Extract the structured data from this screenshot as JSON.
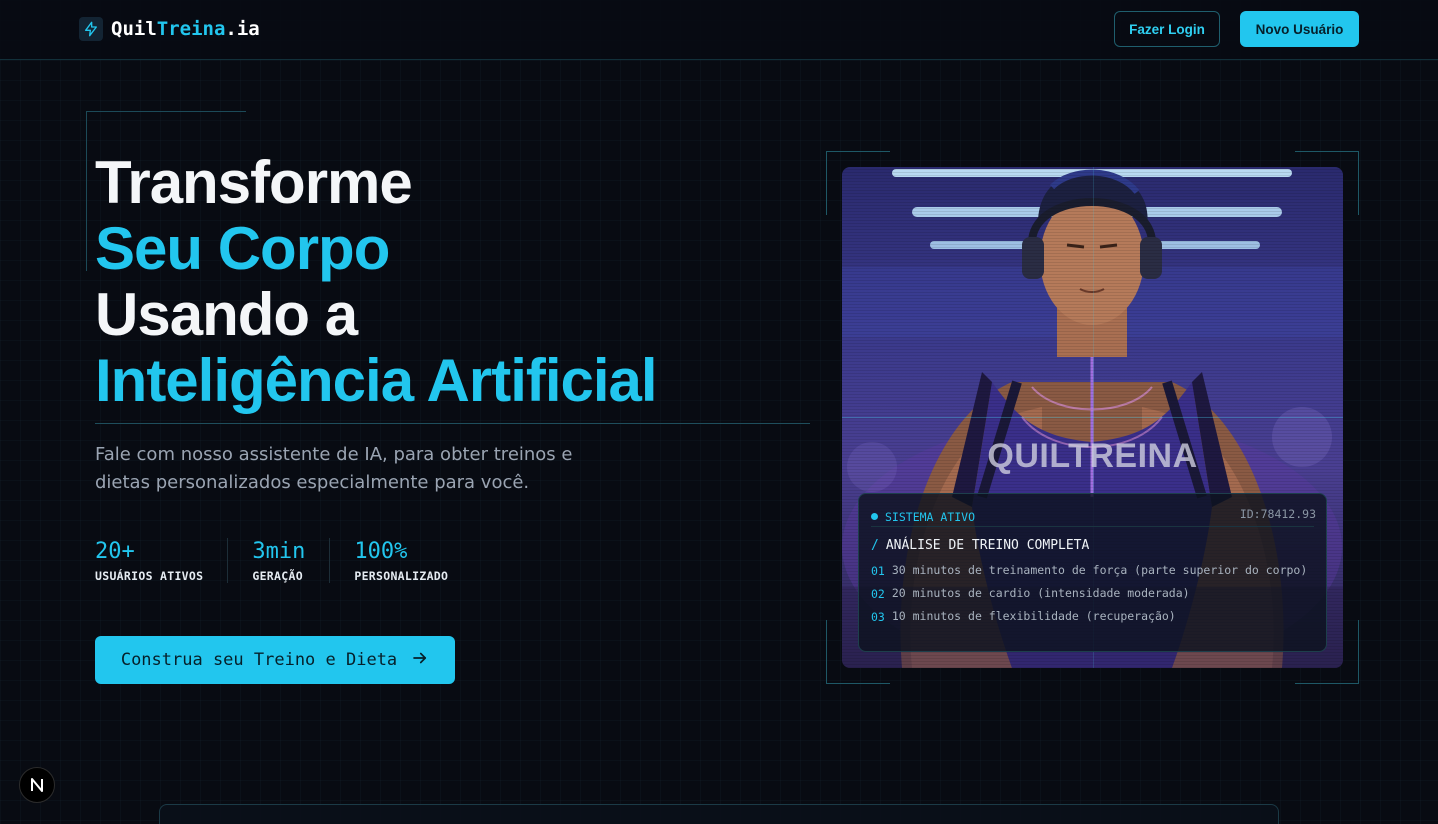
{
  "header": {
    "logo_part1": "Quil",
    "logo_part2": "Treina",
    "logo_part3": ".ia",
    "login_label": "Fazer Login",
    "new_user_label": "Novo Usuário"
  },
  "hero": {
    "line1": "Transforme",
    "line2": "Seu Corpo",
    "line3": "Usando a",
    "line4": "Inteligência Artificial",
    "subtitle": "Fale com nosso assistente de IA, para obter treinos e dietas personalizados especialmente para você.",
    "stats": [
      {
        "value": "20+",
        "label": "USUÁRIOS ATIVOS"
      },
      {
        "value": "3min",
        "label": "GERAÇÃO"
      },
      {
        "value": "100%",
        "label": "PERSONALIZADO"
      }
    ],
    "cta_label": "Construa seu Treino e Dieta"
  },
  "image": {
    "watermark": "QUILTREINA"
  },
  "analysis": {
    "status": "SISTEMA ATIVO",
    "id": "ID:78412.93",
    "title": "ANÁLISE DE TREINO COMPLETA",
    "items": [
      {
        "num": "01",
        "text": "30 minutos de treinamento de força (parte superior do corpo)"
      },
      {
        "num": "02",
        "text": "20 minutos de cardio (intensidade moderada)"
      },
      {
        "num": "03",
        "text": "10 minutos de flexibilidade (recuperação)"
      }
    ]
  },
  "badge": {
    "letter": "N"
  },
  "colors": {
    "background": "#080b12",
    "accent": "#22c6ee",
    "text_primary": "#f4f6f8",
    "text_muted": "#9aa4b2"
  },
  "icons": {
    "logo": "lightning-bolt-icon",
    "cta": "arrow-right-icon"
  }
}
